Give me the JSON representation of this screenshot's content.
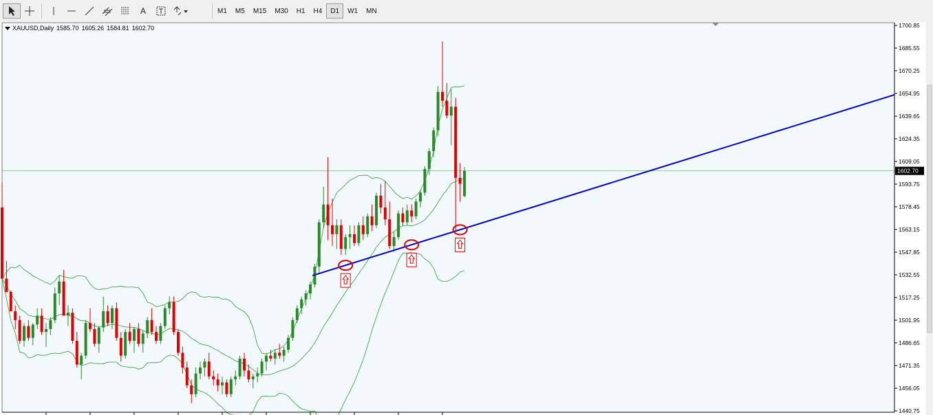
{
  "toolbar": {
    "tools": [
      {
        "name": "cursor-icon",
        "selected": true
      },
      {
        "name": "crosshair-icon",
        "selected": false
      },
      {
        "name": "vertical-line-icon",
        "selected": false
      },
      {
        "name": "horizontal-line-icon",
        "selected": false
      },
      {
        "name": "trendline-icon",
        "selected": false
      },
      {
        "name": "equidistant-channel-icon",
        "selected": false
      },
      {
        "name": "fibonacci-icon",
        "selected": false
      },
      {
        "name": "text-icon",
        "selected": false
      },
      {
        "name": "text-label-icon",
        "selected": false
      },
      {
        "name": "arrows-dropdown-icon",
        "selected": false
      }
    ],
    "text_tool_letter": "A",
    "timeframes": [
      "M1",
      "M5",
      "M15",
      "M30",
      "H1",
      "H4",
      "D1",
      "W1",
      "MN"
    ],
    "active_timeframe": "D1"
  },
  "chart_header": {
    "symbol": "XAUUSD,Daily",
    "open": "1585.70",
    "high": "1605.26",
    "low": "1584.81",
    "close": "1602.70"
  },
  "chart_data": {
    "type": "candlestick",
    "symbol": "XAUUSD",
    "timeframe": "Daily",
    "ylim": [
      1440.75,
      1700.85
    ],
    "y_ticks": [
      "1700.85",
      "1685.55",
      "1670.25",
      "1654.95",
      "1639.65",
      "1624.35",
      "1609.05",
      "1593.75",
      "1578.45",
      "1563.15",
      "1547.85",
      "1532.55",
      "1517.25",
      "1501.95",
      "1486.65",
      "1471.35",
      "1456.05",
      "1440.75"
    ],
    "current_price": "1602.70",
    "colors": {
      "up": "#2a8a2a",
      "down": "#e00000",
      "bands": "#2e9e2e",
      "trendline": "#0000cc",
      "marker": "#e00000",
      "bg": "#f3f8fc"
    },
    "candles": [
      [
        1578,
        1595,
        1540,
        1530
      ],
      [
        1530,
        1542,
        1522,
        1521
      ],
      [
        1521,
        1522,
        1515,
        1508
      ],
      [
        1508,
        1512,
        1496,
        1502
      ],
      [
        1502,
        1505,
        1486,
        1488
      ],
      [
        1488,
        1500,
        1484,
        1498
      ],
      [
        1498,
        1502,
        1488,
        1490
      ],
      [
        1490,
        1500,
        1485,
        1499
      ],
      [
        1499,
        1510,
        1496,
        1505
      ],
      [
        1505,
        1510,
        1492,
        1494
      ],
      [
        1494,
        1500,
        1484,
        1496
      ],
      [
        1496,
        1504,
        1492,
        1502
      ],
      [
        1502,
        1524,
        1500,
        1520
      ],
      [
        1520,
        1532,
        1512,
        1528
      ],
      [
        1528,
        1536,
        1520,
        1505
      ],
      [
        1505,
        1512,
        1498,
        1507
      ],
      [
        1507,
        1510,
        1486,
        1488
      ],
      [
        1488,
        1494,
        1470,
        1472
      ],
      [
        1472,
        1480,
        1462,
        1478
      ],
      [
        1478,
        1502,
        1476,
        1500
      ],
      [
        1500,
        1510,
        1494,
        1496
      ],
      [
        1496,
        1500,
        1484,
        1486
      ],
      [
        1486,
        1498,
        1480,
        1497
      ],
      [
        1497,
        1518,
        1494,
        1508
      ],
      [
        1508,
        1512,
        1498,
        1500
      ],
      [
        1500,
        1512,
        1496,
        1510
      ],
      [
        1510,
        1514,
        1488,
        1490
      ],
      [
        1490,
        1494,
        1474,
        1478
      ],
      [
        1478,
        1496,
        1476,
        1494
      ],
      [
        1494,
        1500,
        1486,
        1488
      ],
      [
        1488,
        1497,
        1480,
        1496
      ],
      [
        1496,
        1500,
        1484,
        1486
      ],
      [
        1486,
        1495,
        1480,
        1493
      ],
      [
        1493,
        1504,
        1490,
        1502
      ],
      [
        1502,
        1510,
        1492,
        1494
      ],
      [
        1494,
        1498,
        1486,
        1488
      ],
      [
        1488,
        1500,
        1486,
        1498
      ],
      [
        1498,
        1512,
        1496,
        1510
      ],
      [
        1510,
        1518,
        1506,
        1514
      ],
      [
        1514,
        1518,
        1492,
        1494
      ],
      [
        1494,
        1496,
        1478,
        1480
      ],
      [
        1480,
        1484,
        1466,
        1470
      ],
      [
        1470,
        1474,
        1456,
        1458
      ],
      [
        1458,
        1462,
        1446,
        1452
      ],
      [
        1452,
        1470,
        1450,
        1466
      ],
      [
        1466,
        1474,
        1462,
        1470
      ],
      [
        1470,
        1476,
        1464,
        1474
      ],
      [
        1474,
        1480,
        1462,
        1464
      ],
      [
        1464,
        1468,
        1458,
        1462
      ],
      [
        1462,
        1466,
        1454,
        1458
      ],
      [
        1458,
        1464,
        1452,
        1460
      ],
      [
        1460,
        1462,
        1450,
        1452
      ],
      [
        1452,
        1464,
        1450,
        1462
      ],
      [
        1462,
        1468,
        1458,
        1464
      ],
      [
        1464,
        1478,
        1462,
        1476
      ],
      [
        1476,
        1480,
        1464,
        1468
      ],
      [
        1468,
        1472,
        1460,
        1462
      ],
      [
        1462,
        1466,
        1456,
        1464
      ],
      [
        1464,
        1470,
        1460,
        1466
      ],
      [
        1466,
        1476,
        1464,
        1474
      ],
      [
        1474,
        1480,
        1468,
        1478
      ],
      [
        1478,
        1482,
        1474,
        1476
      ],
      [
        1476,
        1482,
        1472,
        1480
      ],
      [
        1480,
        1486,
        1476,
        1478
      ],
      [
        1478,
        1484,
        1474,
        1482
      ],
      [
        1482,
        1492,
        1480,
        1490
      ],
      [
        1490,
        1504,
        1488,
        1502
      ],
      [
        1502,
        1512,
        1500,
        1510
      ],
      [
        1510,
        1518,
        1506,
        1516
      ],
      [
        1516,
        1522,
        1512,
        1520
      ],
      [
        1520,
        1528,
        1516,
        1526
      ],
      [
        1526,
        1540,
        1524,
        1538
      ],
      [
        1538,
        1570,
        1534,
        1568
      ],
      [
        1568,
        1592,
        1564,
        1580
      ],
      [
        1580,
        1612,
        1556,
        1566
      ],
      [
        1566,
        1584,
        1552,
        1560
      ],
      [
        1560,
        1570,
        1550,
        1566
      ],
      [
        1566,
        1570,
        1546,
        1550
      ],
      [
        1550,
        1560,
        1546,
        1558
      ],
      [
        1558,
        1566,
        1550,
        1560
      ],
      [
        1560,
        1566,
        1552,
        1554
      ],
      [
        1554,
        1568,
        1552,
        1566
      ],
      [
        1566,
        1572,
        1556,
        1560
      ],
      [
        1560,
        1574,
        1558,
        1572
      ],
      [
        1572,
        1580,
        1562,
        1566
      ],
      [
        1566,
        1588,
        1564,
        1586
      ],
      [
        1586,
        1594,
        1574,
        1578
      ],
      [
        1578,
        1596,
        1566,
        1570
      ],
      [
        1570,
        1582,
        1550,
        1552
      ],
      [
        1552,
        1562,
        1548,
        1558
      ],
      [
        1558,
        1576,
        1556,
        1574
      ],
      [
        1574,
        1578,
        1566,
        1568
      ],
      [
        1568,
        1580,
        1566,
        1576
      ],
      [
        1576,
        1580,
        1568,
        1572
      ],
      [
        1572,
        1584,
        1570,
        1582
      ],
      [
        1582,
        1590,
        1578,
        1588
      ],
      [
        1588,
        1606,
        1586,
        1604
      ],
      [
        1604,
        1618,
        1600,
        1616
      ],
      [
        1616,
        1632,
        1612,
        1630
      ],
      [
        1630,
        1660,
        1626,
        1656
      ],
      [
        1656,
        1690,
        1646,
        1650
      ],
      [
        1650,
        1662,
        1638,
        1640
      ],
      [
        1640,
        1658,
        1620,
        1646
      ],
      [
        1646,
        1652,
        1562,
        1598
      ],
      [
        1598,
        1608,
        1582,
        1594
      ],
      [
        1585.7,
        1605.26,
        1584.81,
        1602.7
      ]
    ],
    "support_markers": [
      {
        "index": 78,
        "price": 1539
      },
      {
        "index": 93,
        "price": 1550
      },
      {
        "index": 104,
        "price": 1563
      }
    ]
  }
}
